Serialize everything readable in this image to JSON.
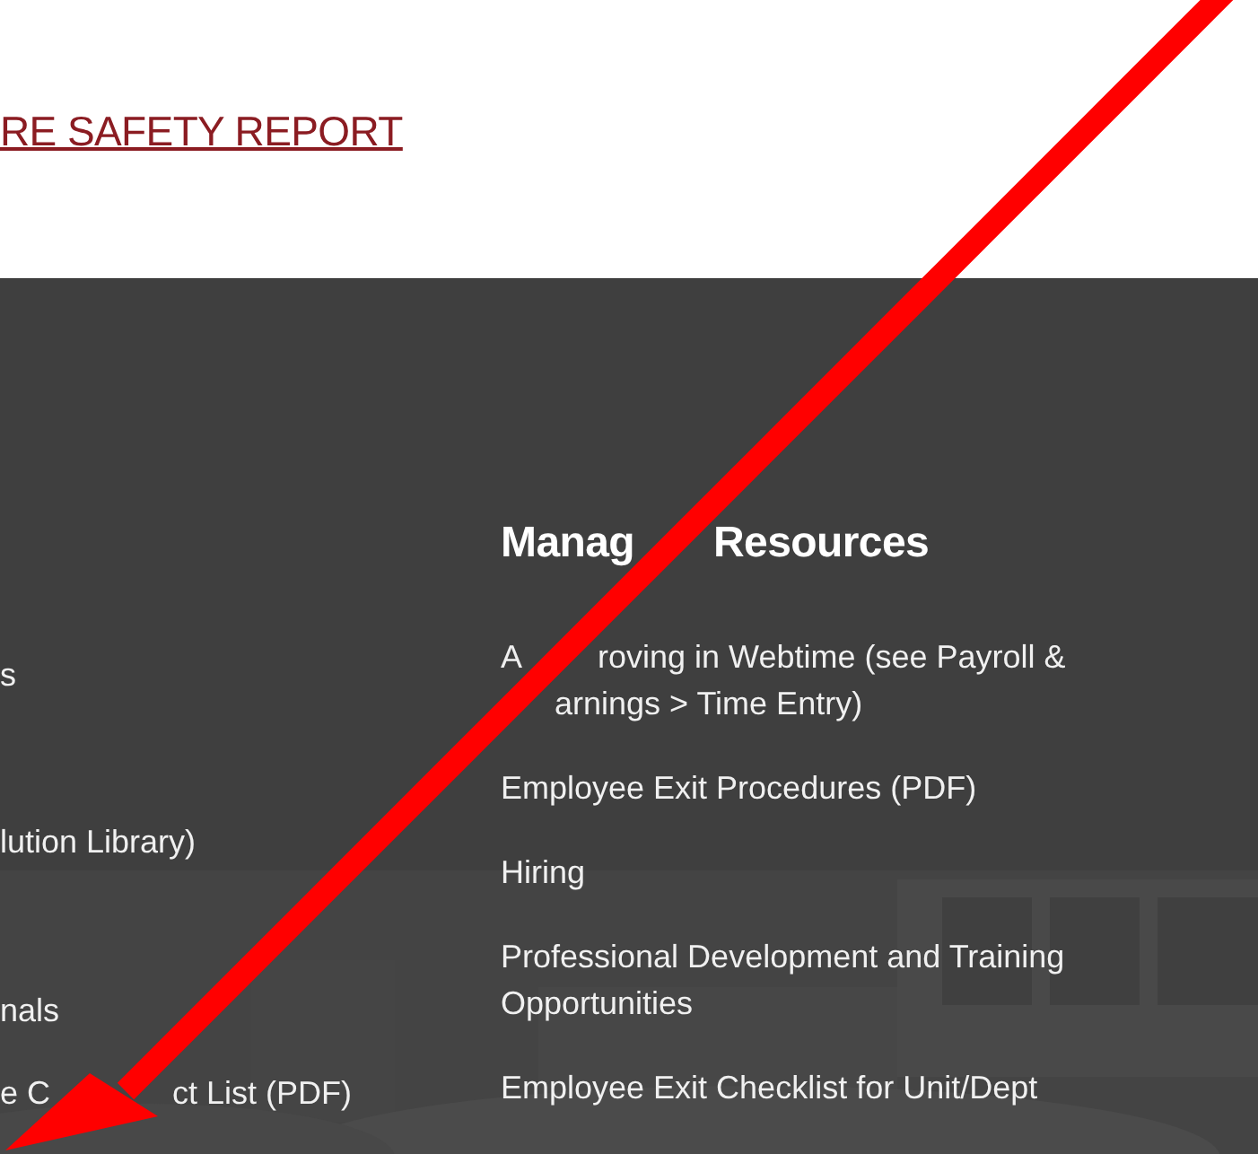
{
  "top_link": "RE SAFETY REPORT",
  "left_column": {
    "items": [
      [
        "s"
      ],
      [
        "lution Library)"
      ],
      [
        "nals"
      ],
      [
        "e C",
        "ct List (PDF)"
      ]
    ]
  },
  "manager_resources": {
    "heading": [
      "Manag",
      "Resources"
    ],
    "items": [
      [
        "A",
        "roving in Webtime (see Payroll &",
        "arnings > Time Entry)"
      ],
      [
        "Employee Exit Procedures (PDF)"
      ],
      [
        "Hiring"
      ],
      [
        "Professional Development and Training Opportunities"
      ],
      [
        "Employee Exit Checklist for Unit/Dept"
      ]
    ]
  }
}
